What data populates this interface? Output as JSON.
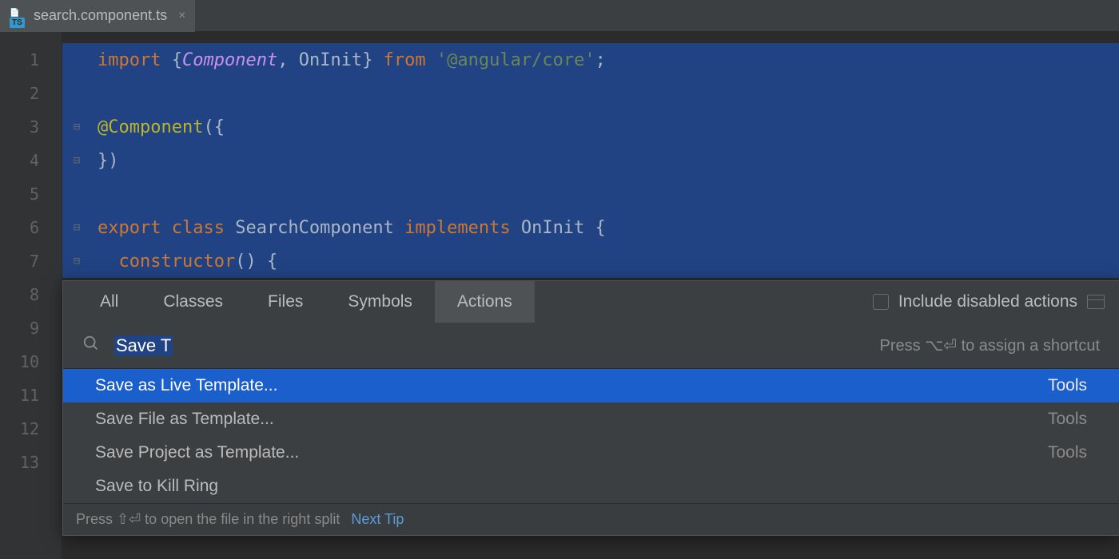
{
  "tab": {
    "file_name": "search.component.ts",
    "icon_badge": "TS"
  },
  "gutter": {
    "lines": [
      "1",
      "2",
      "3",
      "4",
      "5",
      "6",
      "7",
      "8",
      "9",
      "10",
      "11",
      "12",
      "13"
    ]
  },
  "code": {
    "l1": {
      "import": "import",
      "open": " {",
      "component": "Component",
      "comma": ", ",
      "oninit": "OnInit",
      "close": "}",
      "from": " from ",
      "str": "'@angular/core'",
      "semi": ";"
    },
    "l3": {
      "decorator": "@Component",
      "paren": "({"
    },
    "l4": {
      "close": "})"
    },
    "l6": {
      "export": "export ",
      "class": "class ",
      "name": "SearchComponent ",
      "implements": "implements ",
      "iface": "OnInit {"
    },
    "l7": {
      "indent": "  ",
      "ctor": "constructor",
      "parens": "() {"
    }
  },
  "popup": {
    "tabs": {
      "all": "All",
      "classes": "Classes",
      "files": "Files",
      "symbols": "Symbols",
      "actions": "Actions"
    },
    "include_label": "Include disabled actions",
    "search_value": "Save T",
    "shortcut_hint": "Press ⌥⏎ to assign a shortcut",
    "results": [
      {
        "label": "Save as Live Template...",
        "category": "Tools",
        "selected": true
      },
      {
        "label": "Save File as Template...",
        "category": "Tools",
        "selected": false
      },
      {
        "label": "Save Project as Template...",
        "category": "Tools",
        "selected": false
      },
      {
        "label": "Save to Kill Ring",
        "category": "",
        "selected": false
      }
    ],
    "footer_text": "Press ⇧⏎ to open the file in the right split",
    "footer_link": "Next Tip"
  }
}
